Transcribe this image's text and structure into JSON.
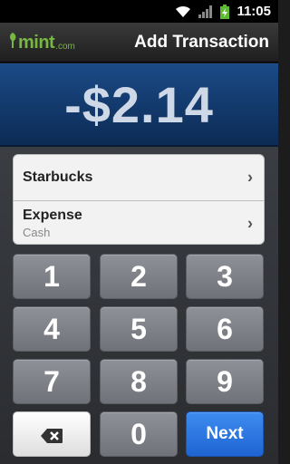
{
  "status_bar": {
    "time": "11:05"
  },
  "header": {
    "brand": "mint",
    "brand_suffix": ".com",
    "title": "Add Transaction"
  },
  "amount": "-$2.14",
  "details": [
    {
      "label": "Starbucks"
    },
    {
      "label": "Expense",
      "sublabel": "Cash"
    }
  ],
  "keypad": {
    "keys": [
      "1",
      "2",
      "3",
      "4",
      "5",
      "6",
      "7",
      "8",
      "9"
    ],
    "zero": "0",
    "next": "Next"
  },
  "colors": {
    "brand_green": "#79b744",
    "amount_bg": "#1b4a86",
    "next_blue": "#2f7ae5"
  }
}
